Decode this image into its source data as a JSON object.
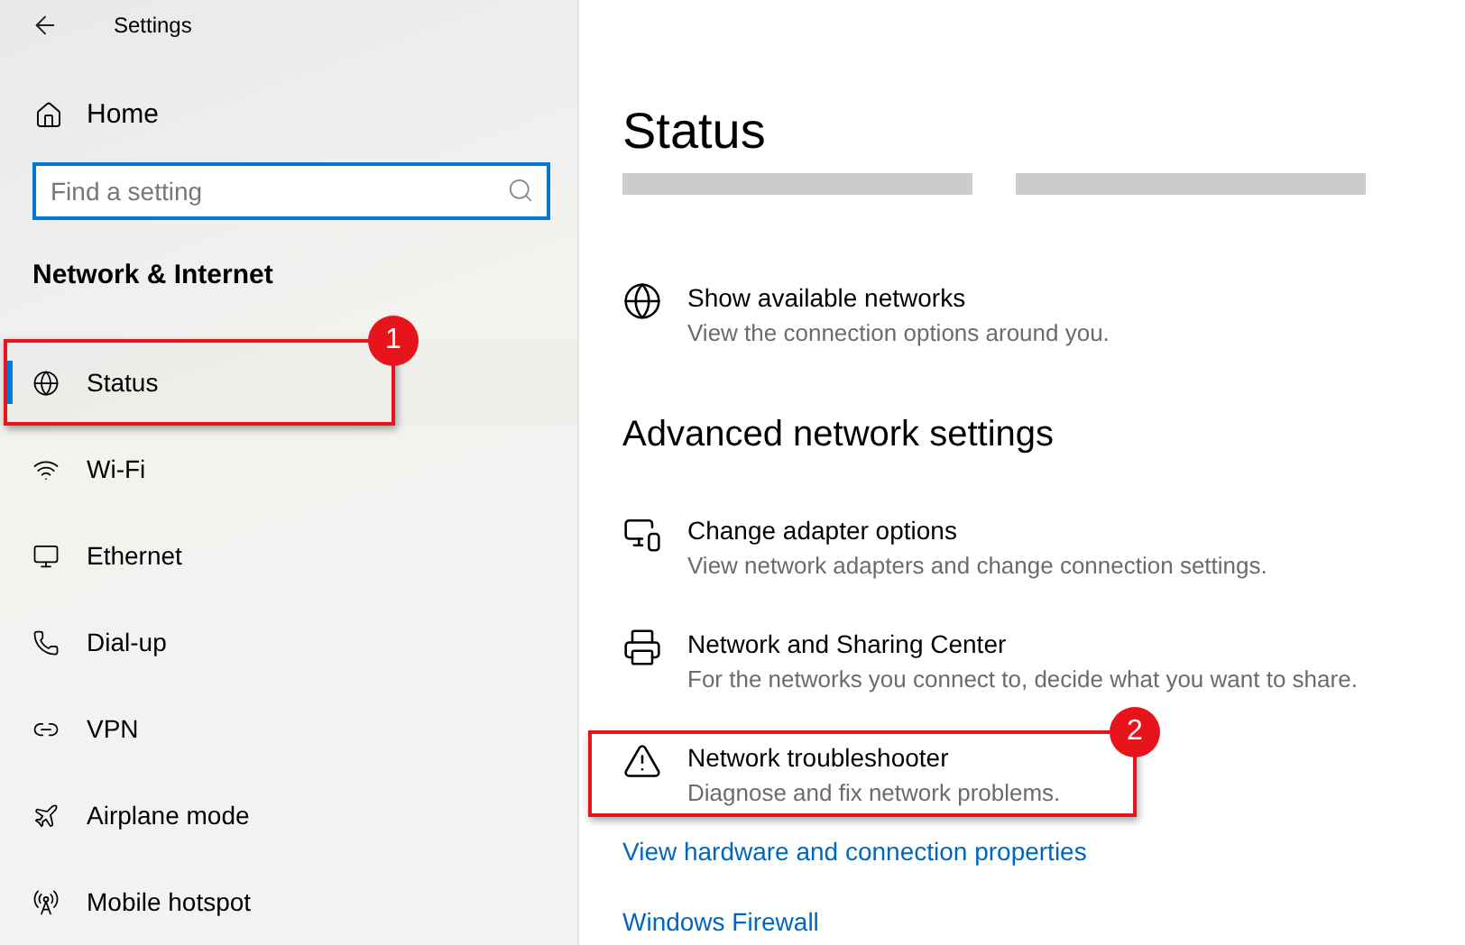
{
  "window": {
    "title": "Settings"
  },
  "sidebar": {
    "home": "Home",
    "search": {
      "placeholder": "Find a setting"
    },
    "section": "Network & Internet",
    "items": [
      {
        "label": "Status",
        "kind": "status",
        "selected": true,
        "callout": "1"
      },
      {
        "label": "Wi-Fi",
        "kind": "wifi",
        "selected": false
      },
      {
        "label": "Ethernet",
        "kind": "ethernet",
        "selected": false
      },
      {
        "label": "Dial-up",
        "kind": "dialup",
        "selected": false
      },
      {
        "label": "VPN",
        "kind": "vpn",
        "selected": false
      },
      {
        "label": "Airplane mode",
        "kind": "airplane",
        "selected": false
      },
      {
        "label": "Mobile hotspot",
        "kind": "hotspot",
        "selected": false
      }
    ]
  },
  "main": {
    "title": "Status",
    "top_settings": [
      {
        "title": "Show available networks",
        "description": "View the connection options around you.",
        "kind": "status"
      }
    ],
    "section": "Advanced network settings",
    "settings": [
      {
        "title": "Change adapter options",
        "description": "View network adapters and change connection settings.",
        "kind": "adapter"
      },
      {
        "title": "Network and Sharing Center",
        "description": "For the networks you connect to, decide what you want to share.",
        "kind": "sharing"
      },
      {
        "title": "Network troubleshooter",
        "description": "Diagnose and fix network problems.",
        "kind": "warning",
        "callout": "2"
      }
    ],
    "links": [
      "View hardware and connection properties",
      "Windows Firewall"
    ]
  }
}
